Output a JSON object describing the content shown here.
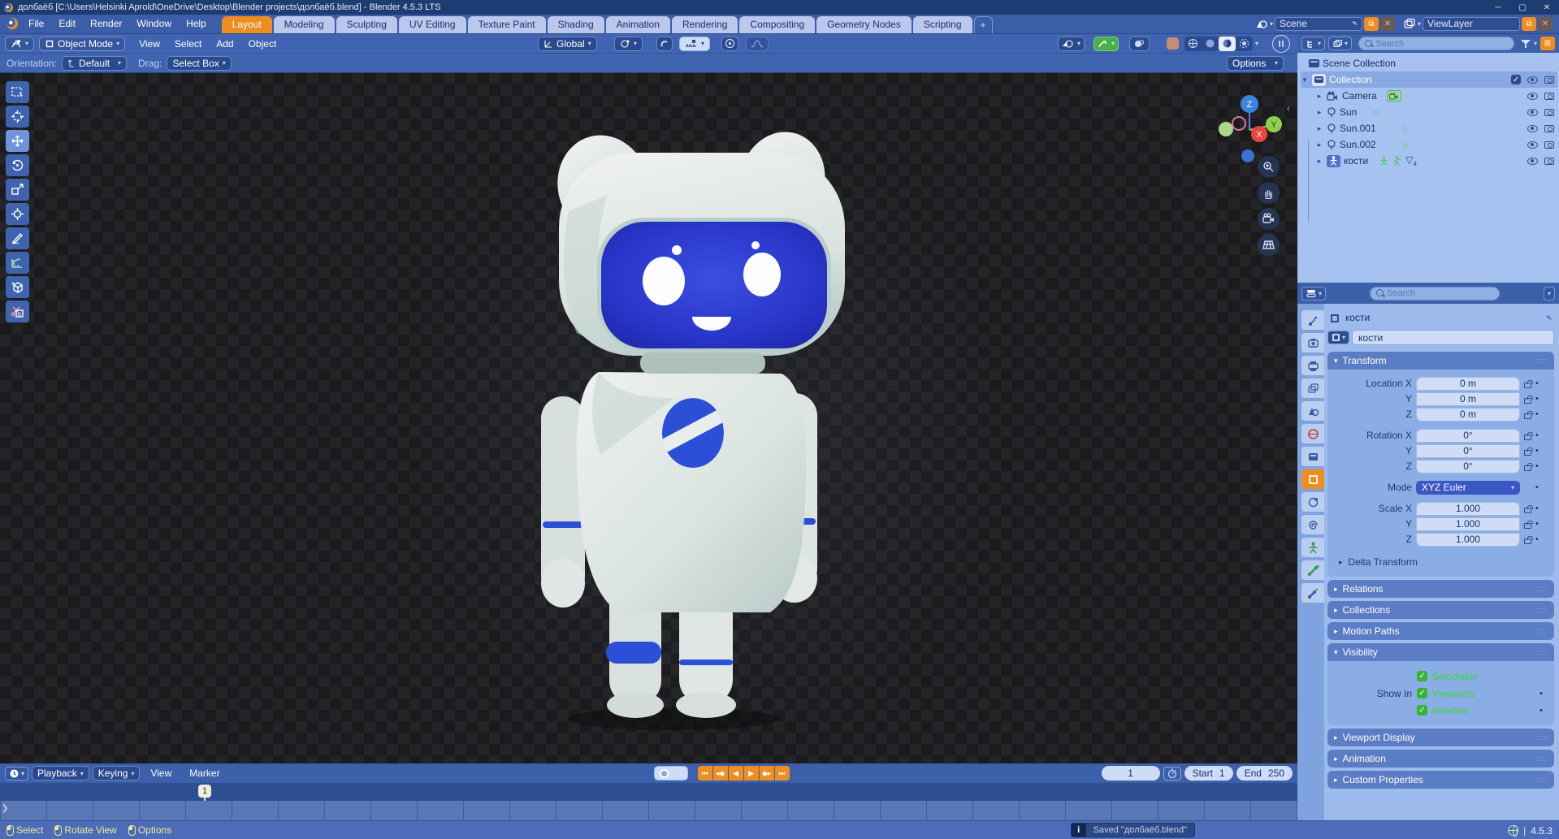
{
  "app": {
    "title": "долбаёб [C:\\Users\\Helsinki Aprold\\OneDrive\\Desktop\\Blender projects\\долбаёб.blend] - Blender 4.5.3 LTS",
    "version": "4.5.3"
  },
  "titlebar": {
    "minimize": "─",
    "maximize": "▢",
    "close": "✕"
  },
  "topbar": {
    "menus": [
      "File",
      "Edit",
      "Render",
      "Window",
      "Help"
    ],
    "tabs": [
      "Layout",
      "Modeling",
      "Sculpting",
      "UV Editing",
      "Texture Paint",
      "Shading",
      "Animation",
      "Rendering",
      "Compositing",
      "Geometry Nodes",
      "Scripting"
    ],
    "active_tab": "Layout",
    "new_tab": "+",
    "scene_value": "Scene",
    "viewlayer_value": "ViewLayer"
  },
  "viewport": {
    "mode": "Object Mode",
    "menus": [
      "View",
      "Select",
      "Add",
      "Object"
    ],
    "orientation": "Global",
    "tool_settings": {
      "orientation_label": "Orientation:",
      "orientation_value": "Default",
      "drag_label": "Drag:",
      "drag_value": "Select Box",
      "options": "Options"
    },
    "gizmo": {
      "x": "X",
      "y": "Y",
      "z": "Z"
    }
  },
  "outliner": {
    "search_placeholder": "Search",
    "rows": [
      {
        "label": "Scene Collection"
      },
      {
        "label": "Collection"
      },
      {
        "label": "Camera"
      },
      {
        "label": "Sun"
      },
      {
        "label": "Sun.001"
      },
      {
        "label": "Sun.002"
      },
      {
        "label": "кости",
        "data_badge": "▽",
        "data_badge_sub": "4"
      }
    ]
  },
  "properties": {
    "search_placeholder": "Search",
    "breadcrumb": "кости",
    "name_field": "кости",
    "transform": {
      "title": "Transform",
      "rows": [
        {
          "label": "Location X",
          "value": "0 m"
        },
        {
          "label": "Y",
          "value": "0 m"
        },
        {
          "label": "Z",
          "value": "0 m"
        },
        {
          "label": "Rotation X",
          "value": "0°"
        },
        {
          "label": "Y",
          "value": "0°"
        },
        {
          "label": "Z",
          "value": "0°"
        },
        {
          "label": "Mode",
          "value": "XYZ Euler"
        },
        {
          "label": "Scale X",
          "value": "1.000"
        },
        {
          "label": "Y",
          "value": "1.000"
        },
        {
          "label": "Z",
          "value": "1.000"
        }
      ],
      "delta_label": "Delta Transform"
    },
    "collapsed_panels": [
      "Relations",
      "Collections",
      "Motion Paths"
    ],
    "visibility": {
      "title": "Visibility",
      "selectable": "Selectable",
      "show_in": "Show In",
      "viewports": "Viewports",
      "renders": "Renders"
    },
    "bottom_panels": [
      "Viewport Display",
      "Animation",
      "Custom Properties"
    ]
  },
  "timeline": {
    "menus": [
      "Playback",
      "Keying",
      "View",
      "Marker"
    ],
    "current_frame": "1",
    "playhead": "1",
    "start_label": "Start",
    "start_value": "1",
    "end_label": "End",
    "end_value": "250"
  },
  "statusbar": {
    "hints": [
      "Select",
      "Rotate View",
      "Options"
    ],
    "saved_message": "Saved \"долбаёб.blend\"",
    "version": "4.5.3"
  },
  "colors": {
    "accent_orange": "#ee8e21",
    "header_blue": "#3d60ab",
    "outliner_bg": "#a6c2f0",
    "field_bg": "#cfdcf6",
    "enabled_green": "#3fd43f",
    "mode_dropdown_blue": "#3b57c4",
    "face_screen_blue": "#2b3bd0",
    "body_white": "#e3e8e6"
  }
}
